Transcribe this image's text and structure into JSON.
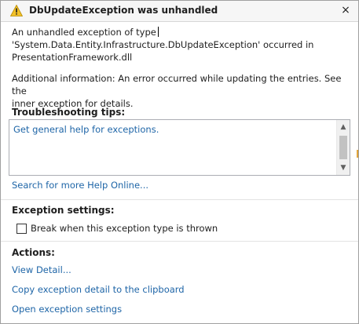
{
  "dialog": {
    "title": "DbUpdateException was unhandled",
    "close_glyph": "×",
    "message_line1": "An unhandled exception of type",
    "message_line2": "'System.Data.Entity.Infrastructure.DbUpdateException' occurred in",
    "message_line3": "PresentationFramework.dll",
    "additional_line1": "Additional information: An error occurred while updating the entries. See the",
    "additional_line2": "inner exception for details."
  },
  "troubleshooting": {
    "heading": "Troubleshooting tips:",
    "tips": [
      "Get general help for exceptions."
    ],
    "scroll_up": "^",
    "scroll_down": "v",
    "search_link": "Search for more Help Online..."
  },
  "exception_settings": {
    "heading": "Exception settings:",
    "break_when_thrown_label": "Break when this exception type is thrown",
    "break_when_thrown_checked": false
  },
  "actions": {
    "heading": "Actions:",
    "items": [
      "View Detail...",
      "Copy exception detail to the clipboard",
      "Open exception settings"
    ]
  },
  "icons": {
    "warning": "warning-icon",
    "close": "close-icon"
  },
  "colors": {
    "link": "#1e65a7",
    "warning_fill": "#f2c128",
    "text": "#1e1e1e"
  }
}
